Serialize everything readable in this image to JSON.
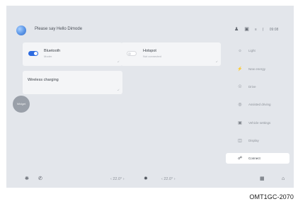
{
  "header": {
    "greeting": "Please say Hello Dimode",
    "icons": [
      "user-icon",
      "camera-icon",
      "signal-icon",
      "wifi-icon"
    ],
    "time": "09:08"
  },
  "cards": {
    "bluetooth": {
      "title": "Bluetooth",
      "subtitle": "Moder",
      "enabled": true
    },
    "hotspot": {
      "title": "Hotspot",
      "subtitle": "Not connected",
      "enabled": false
    },
    "wireless": {
      "title": "Wireless charging"
    }
  },
  "side_bubble": {
    "label": "Widget"
  },
  "menu": [
    {
      "icon": "light-icon",
      "label": "Light",
      "active": false
    },
    {
      "icon": "new-energy-icon",
      "label": "New energy",
      "active": false
    },
    {
      "icon": "drive-icon",
      "label": "Drive",
      "active": false
    },
    {
      "icon": "assisted-driving-icon",
      "label": "Assisted driving",
      "active": false
    },
    {
      "icon": "vehicle-settings-icon",
      "label": "Vehicle settings",
      "active": false
    },
    {
      "icon": "display-icon",
      "label": "Display",
      "active": false
    },
    {
      "icon": "connect-icon",
      "label": "Connect",
      "active": true
    }
  ],
  "dock": {
    "left_temp": "‹ 22.0° ›",
    "right_temp": "‹ 22.0° ›",
    "icons": [
      "steering-icon",
      "phone-icon",
      "fan-icon",
      "seat-heat-icon",
      "home-icon"
    ]
  },
  "caption": "OMT1GC-2070"
}
